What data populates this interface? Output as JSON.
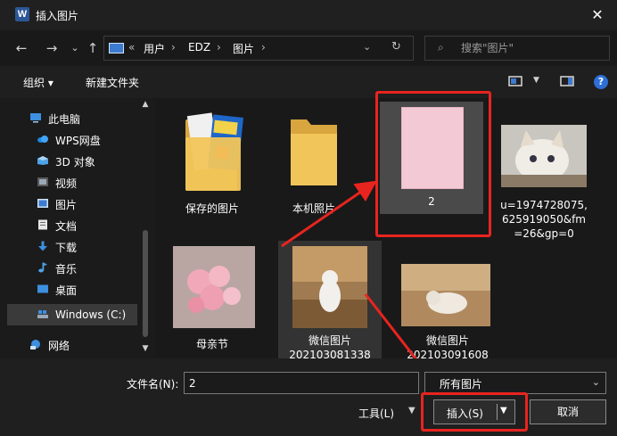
{
  "window": {
    "title": "插入图片",
    "app_icon_letter": "W",
    "close_glyph": "✕"
  },
  "nav": {
    "back": "←",
    "forward": "→",
    "recent": "⌄",
    "up": "↑",
    "address": {
      "overflow": "«",
      "crumbs": [
        "用户",
        "EDZ",
        "图片"
      ],
      "sep": "›"
    },
    "dropdown": "⌄",
    "refresh": "↻",
    "search": {
      "placeholder": "搜索\"图片\"",
      "icon": "⌕"
    }
  },
  "toolbar": {
    "organize": "组织 ▾",
    "new_folder": "新建文件夹",
    "help": "?"
  },
  "sidebar": {
    "items": [
      {
        "label": "此电脑",
        "icon": "computer-icon"
      },
      {
        "label": "WPS网盘",
        "icon": "cloud-icon"
      },
      {
        "label": "3D 对象",
        "icon": "cube-icon"
      },
      {
        "label": "视频",
        "icon": "video-icon"
      },
      {
        "label": "图片",
        "icon": "picture-icon"
      },
      {
        "label": "文档",
        "icon": "document-icon"
      },
      {
        "label": "下载",
        "icon": "download-icon"
      },
      {
        "label": "音乐",
        "icon": "music-icon"
      },
      {
        "label": "桌面",
        "icon": "desktop-icon"
      },
      {
        "label": "Windows (C:)",
        "icon": "drive-icon",
        "selected": true
      },
      {
        "label": "网络",
        "icon": "network-icon"
      }
    ],
    "scroll_up": "▲",
    "scroll_down": "▼"
  },
  "files": [
    {
      "label": "保存的图片",
      "type": "folder-with-images"
    },
    {
      "label": "本机照片",
      "type": "folder"
    },
    {
      "label": "2",
      "type": "image",
      "selected": true
    },
    {
      "label": "u=1974728075,625919050&fm=26&gp=0",
      "label_lines": [
        "u=1974728075,",
        "625919050&fm",
        "=26&gp=0"
      ],
      "type": "image"
    },
    {
      "label": "母亲节",
      "type": "image"
    },
    {
      "label": "微信图片20210308133",
      "label_lines": [
        "微信图片",
        "202103081338"
      ],
      "type": "image"
    },
    {
      "label": "微信图片20210309160",
      "label_lines": [
        "微信图片",
        "202103091608"
      ],
      "type": "image"
    }
  ],
  "bottom": {
    "filename_label": "文件名(N):",
    "filename_value": "2",
    "filetype_value": "所有图片",
    "dropdown_glyph": "⌄",
    "tools_label": "工具(L)",
    "tools_arrow": "▼",
    "insert_label": "插入(S)",
    "insert_dropdown": "▼",
    "cancel_label": "取消"
  },
  "colors": {
    "highlight": "#e8241f",
    "selected_tile": "#4a4a4a",
    "background": "#191919"
  }
}
